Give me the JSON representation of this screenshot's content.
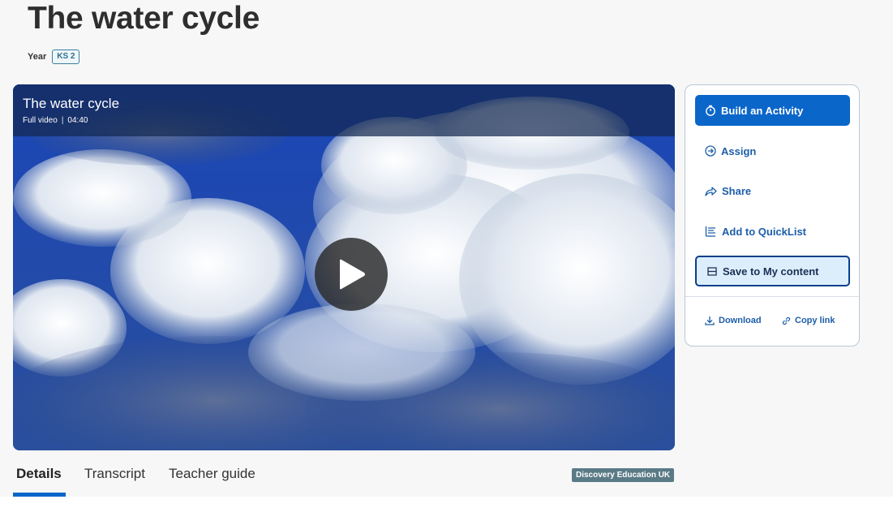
{
  "page": {
    "title": "The water cycle",
    "year_label": "Year",
    "key_stage": "KS 2"
  },
  "video": {
    "title": "The water cycle",
    "type": "Full video",
    "duration": "04:40",
    "play_icon": "play-icon"
  },
  "actions": {
    "build": "Build an Activity",
    "assign": "Assign",
    "share": "Share",
    "quicklist": "Add to QuickList",
    "save": "Save to My content",
    "download": "Download",
    "copy_link": "Copy link"
  },
  "tabs": [
    {
      "label": "Details",
      "active": true
    },
    {
      "label": "Transcript",
      "active": false
    },
    {
      "label": "Teacher guide",
      "active": false
    }
  ],
  "provider": "Discovery Education UK",
  "colors": {
    "primary": "#0b66c9",
    "accent_text": "#1d5ea8",
    "badge": "#5a7a86"
  }
}
